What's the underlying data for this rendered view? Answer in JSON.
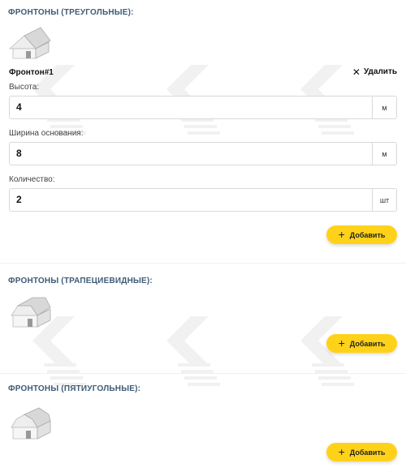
{
  "sections": [
    {
      "title": "ФРОНТОНЫ (ТРЕУГОЛЬНЫЕ):",
      "add_label": "Добавить",
      "item": {
        "title": "Фронтон#1",
        "remove_label": "Удалить",
        "fields": [
          {
            "label": "Высота:",
            "value": "4",
            "unit": "м"
          },
          {
            "label": "Ширина основания:",
            "value": "8",
            "unit": "м"
          },
          {
            "label": "Количество:",
            "value": "2",
            "unit": "шт"
          }
        ]
      }
    },
    {
      "title": "ФРОНТОНЫ (ТРАПЕЦИЕВИДНЫЕ):",
      "add_label": "Добавить"
    },
    {
      "title": "ФРОНТОНЫ (ПЯТИУГОЛЬНЫЕ):",
      "add_label": "Добавить"
    }
  ],
  "icons": {
    "house": "house-icon",
    "close": "close-icon",
    "plus": "plus-icon"
  },
  "colors": {
    "accent": "#ffd21a",
    "title": "#3f5a77",
    "border": "#d9d9d9"
  }
}
